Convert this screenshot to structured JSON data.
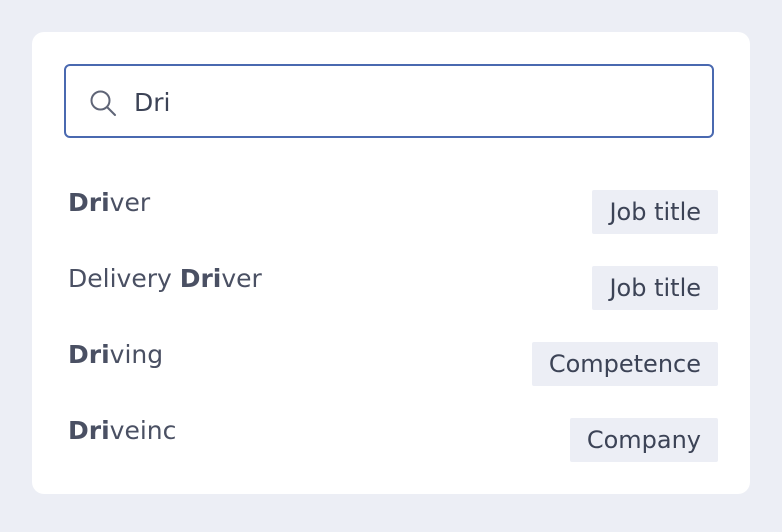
{
  "search": {
    "value": "Dri",
    "icon": "search-icon"
  },
  "results": [
    {
      "before": "",
      "match": "Dri",
      "after": "ver",
      "tag": "Job title"
    },
    {
      "before": "Delivery ",
      "match": "Dri",
      "after": "ver",
      "tag": "Job title"
    },
    {
      "before": "",
      "match": "Dri",
      "after": "ving",
      "tag": "Competence"
    },
    {
      "before": "",
      "match": "Dri",
      "after": "veinc",
      "tag": "Company"
    }
  ],
  "colors": {
    "background": "#eceef5",
    "card": "#ffffff",
    "focus_border": "#4a69b0",
    "text": "#4a5063",
    "tag_background": "#eceef5"
  }
}
